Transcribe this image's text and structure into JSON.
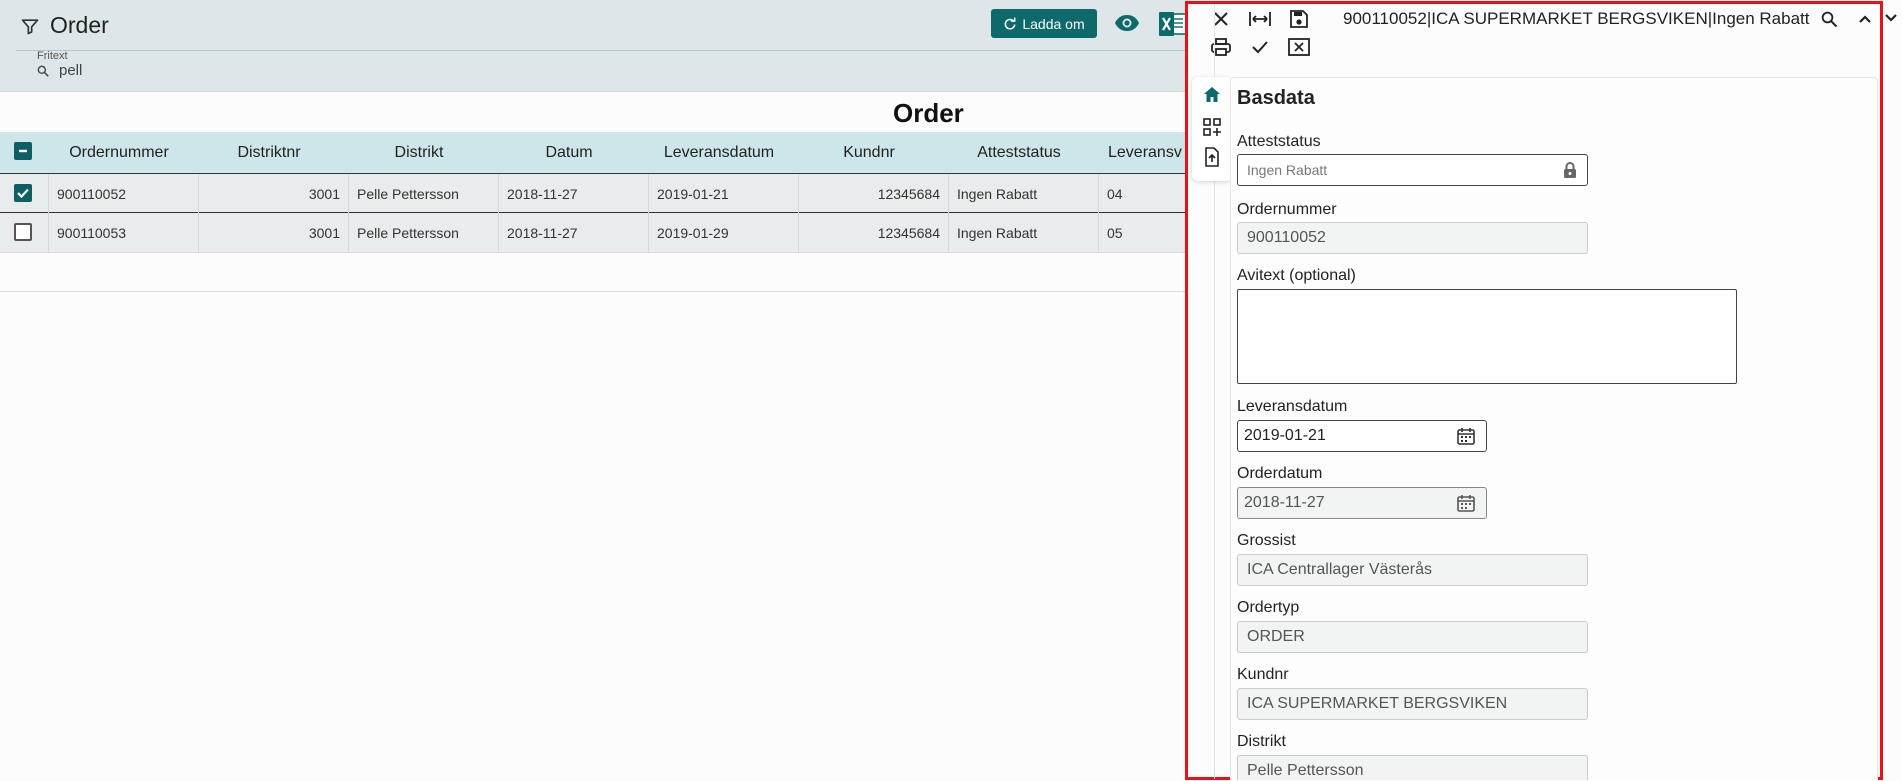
{
  "header": {
    "title": "Order",
    "search_label": "Fritext",
    "search_value": "pell",
    "reload_label": "Ladda om"
  },
  "table": {
    "title": "Order",
    "columns": [
      "Ordernummer",
      "Distriktnr",
      "Distrikt",
      "Datum",
      "Leveransdatum",
      "Kundnr",
      "Atteststatus",
      "Leveransv"
    ],
    "rows": [
      {
        "ordernummer": "900110052",
        "distriktnr": "3001",
        "distrikt": "Pelle Pettersson",
        "datum": "2018-11-27",
        "leveransdatum": "2019-01-21",
        "kundnr": "12345684",
        "atteststatus": "Ingen Rabatt",
        "leveransv": "04",
        "checked": true
      },
      {
        "ordernummer": "900110053",
        "distriktnr": "3001",
        "distrikt": "Pelle Pettersson",
        "datum": "2018-11-27",
        "leveransdatum": "2019-01-29",
        "kundnr": "12345684",
        "atteststatus": "Ingen Rabatt",
        "leveransv": "05",
        "checked": false
      }
    ]
  },
  "panel": {
    "title": "900110052|ICA SUPERMARKET BERGSVIKEN|Ingen Rabatt",
    "section_title": "Basdata",
    "fields": {
      "atteststatus": {
        "label": "Atteststatus",
        "value": "Ingen Rabatt"
      },
      "ordernummer": {
        "label": "Ordernummer",
        "value": "900110052"
      },
      "avitext": {
        "label": "Avitext (optional)",
        "value": ""
      },
      "leveransdatum": {
        "label": "Leveransdatum",
        "value": "2019-01-21"
      },
      "orderdatum": {
        "label": "Orderdatum",
        "value": "2018-11-27"
      },
      "grossist": {
        "label": "Grossist",
        "value": "ICA Centrallager Västerås"
      },
      "ordertyp": {
        "label": "Ordertyp",
        "value": "ORDER"
      },
      "kundnr": {
        "label": "Kundnr",
        "value": "ICA SUPERMARKET BERGSVIKEN"
      },
      "distrikt": {
        "label": "Distrikt",
        "value": "Pelle Pettersson"
      }
    }
  },
  "icons": {
    "filter": "filter-icon",
    "search": "search-icon",
    "reload": "refresh-icon",
    "eye": "eye-icon",
    "excel": "excel-icon",
    "close": "close-icon",
    "fit_width": "fit-width-icon",
    "save": "save-icon",
    "find": "search-icon",
    "collapse": "chevron-up-icon",
    "expand": "chevron-down-icon",
    "print": "print-icon",
    "approve": "check-icon",
    "reject": "close-box-icon",
    "home": "home-icon",
    "qr": "qr-add-icon",
    "export": "file-export-icon",
    "lock": "lock-icon",
    "calendar": "calendar-icon"
  },
  "colors": {
    "accent": "#0e6a6a",
    "header_bg": "#dde6e8",
    "table_header_bg": "#cde6ea",
    "panel_border": "#e8111a"
  }
}
